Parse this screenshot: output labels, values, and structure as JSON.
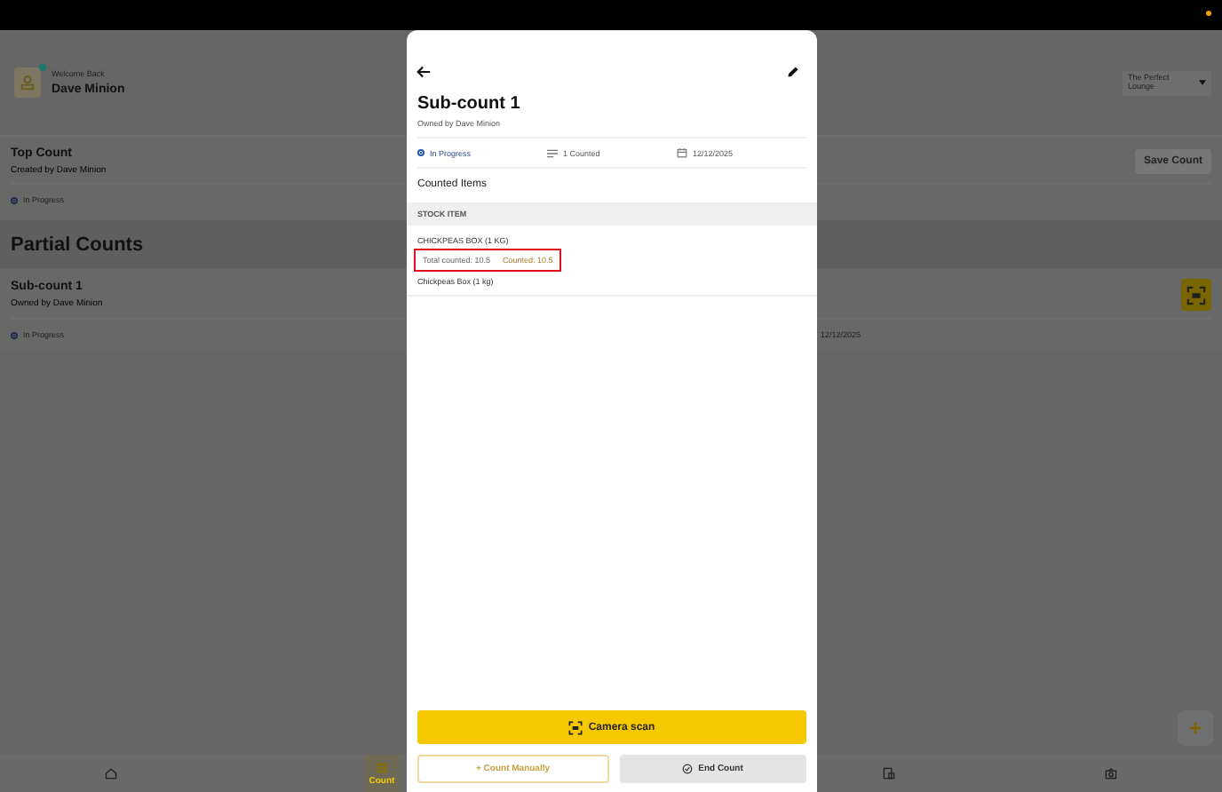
{
  "header": {
    "greeting": "Welcome Back",
    "user": "Dave Minion",
    "online": true,
    "location": "The Perfect Lounge"
  },
  "top_count": {
    "title": "Top Count",
    "subtitle": "Created by Dave Minion",
    "status": "In Progress",
    "button": "Save Count"
  },
  "section_title": "Partial Counts",
  "partial_counts": [
    {
      "title": "Sub-count 1",
      "subtitle": "Owned by Dave Minion",
      "status": "In Progress",
      "date": "12/12/2025"
    }
  ],
  "bottom_nav": [
    {
      "kind": "home",
      "selected": false
    },
    {
      "kind": "count",
      "label": "Count",
      "selected": true
    },
    {
      "kind": "box",
      "selected": false
    },
    {
      "kind": "camera",
      "selected": false
    }
  ],
  "modal": {
    "title": "Sub-count 1",
    "subtitle": "Owned by Dave Minion",
    "status": "In Progress",
    "counted": "1 Counted",
    "date": "12/12/2025",
    "section": "Counted Items",
    "column": "STOCK ITEM",
    "items": [
      {
        "name": "CHICKPEAS BOX (1 KG)",
        "total": "Total counted: 10.5",
        "counted": "Counted: 10.5",
        "highlighted": true,
        "detail": "Chickpeas Box (1 kg)"
      }
    ],
    "camera_button": "Camera scan",
    "manual_button": "+ Count Manually",
    "end_button": "End Count"
  }
}
